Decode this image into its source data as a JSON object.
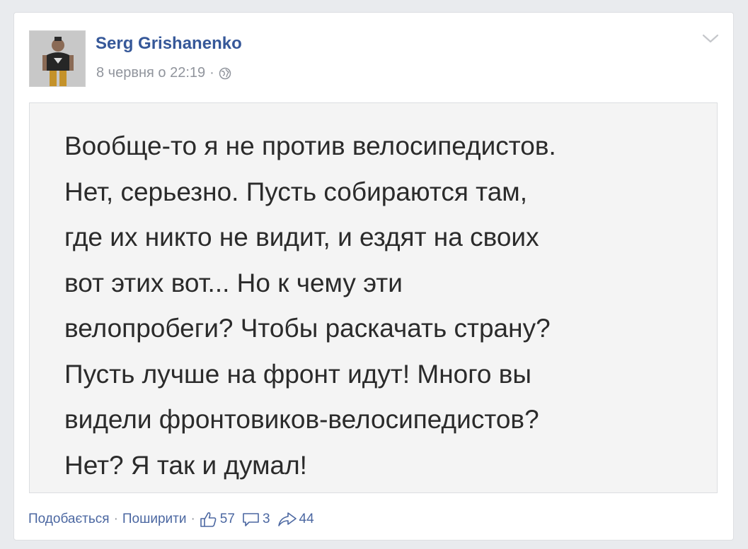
{
  "post": {
    "author": "Serg Grishanenko",
    "timestamp": "8 червня о 22:19",
    "separator": "·",
    "privacy_icon": "globe-icon",
    "options_icon": "chevron-down-icon"
  },
  "image": {
    "lines": [
      "Вообще-то я не против велосипедистов.",
      "Нет, серьезно. Пусть собираются там,",
      "где их никто не видит, и ездят на своих",
      "вот этих вот... Но к чему эти",
      "велопробеги? Чтобы раскачать страну?",
      "Пусть лучше на фронт идут! Много вы",
      "видели фронтовиков-велосипедистов?",
      "Нет? Я так и думал!"
    ]
  },
  "actions": {
    "like_label": "Подобається",
    "share_label": "Поширити",
    "dot": "·",
    "likes_count": "57",
    "comments_count": "3",
    "shares_count": "44"
  },
  "colors": {
    "link": "#365899",
    "action": "#4b67a1",
    "meta": "#90949c"
  }
}
